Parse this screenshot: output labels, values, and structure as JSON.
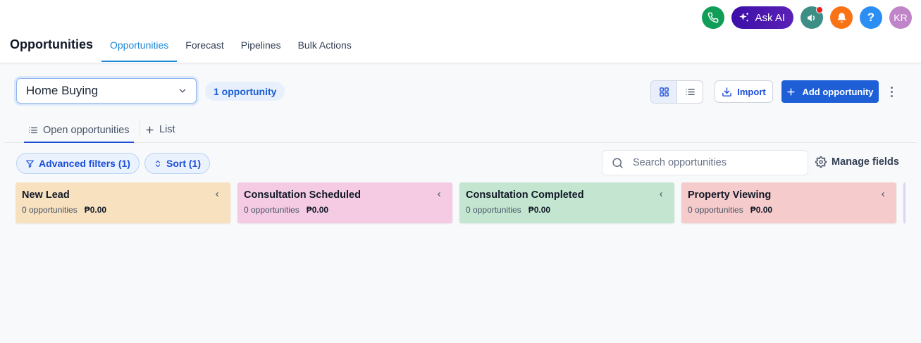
{
  "topbar": {
    "ask_ai_label": "Ask AI",
    "help_label": "?",
    "avatar_initials": "KR"
  },
  "page": {
    "title": "Opportunities",
    "tabs": [
      {
        "label": "Opportunities",
        "active": true
      },
      {
        "label": "Forecast",
        "active": false
      },
      {
        "label": "Pipelines",
        "active": false
      },
      {
        "label": "Bulk Actions",
        "active": false
      }
    ]
  },
  "toolbar": {
    "pipeline_value": "Home Buying",
    "count_badge": "1 opportunity",
    "import_label": "Import",
    "add_label": "Add opportunity"
  },
  "subtabs": {
    "open_label": "Open opportunities",
    "list_label": "List"
  },
  "filters": {
    "advanced_label": "Advanced filters (1)",
    "sort_label": "Sort (1)",
    "search_placeholder": "Search opportunities",
    "manage_label": "Manage fields"
  },
  "board": {
    "columns": [
      {
        "name": "New Lead",
        "count": "0 opportunities",
        "amount": "₱0.00",
        "color": "#f7e1bf"
      },
      {
        "name": "Consultation Scheduled",
        "count": "0 opportunities",
        "amount": "₱0.00",
        "color": "#f5cbe3"
      },
      {
        "name": "Consultation Completed",
        "count": "0 opportunities",
        "amount": "₱0.00",
        "color": "#c4e6d1"
      },
      {
        "name": "Property Viewing",
        "count": "0 opportunities",
        "amount": "₱0.00",
        "color": "#f5cbcb"
      }
    ]
  },
  "colors": {
    "accent": "#1e5fd8",
    "tab_active": "#1e88d6"
  }
}
